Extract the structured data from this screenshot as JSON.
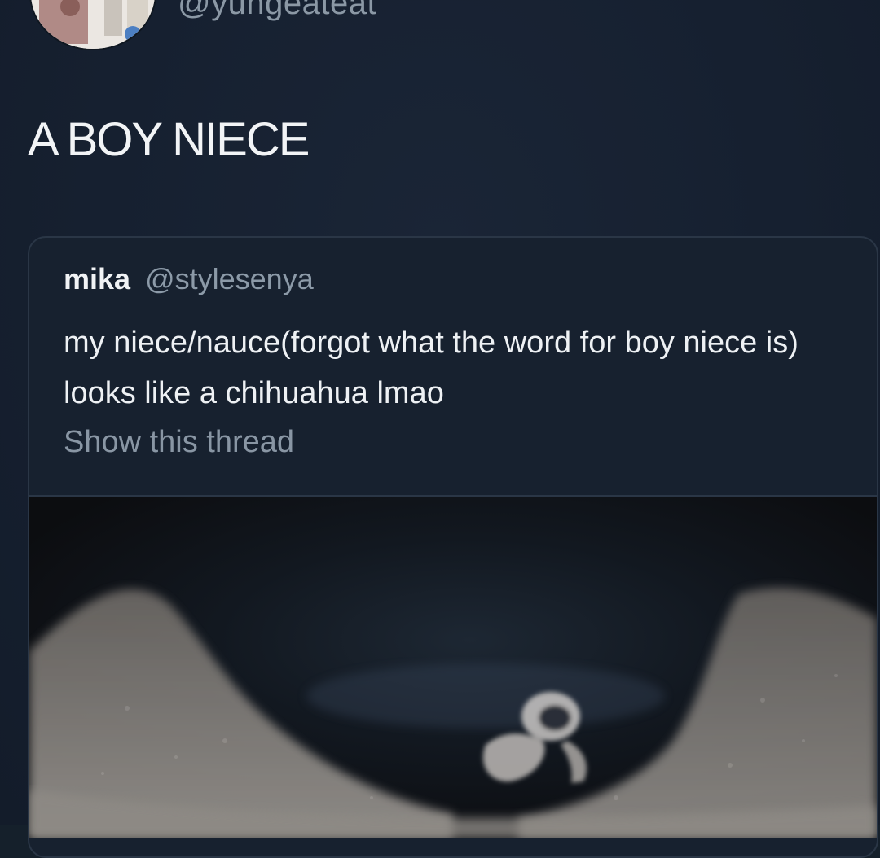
{
  "tweet": {
    "handle": "@yungeateat",
    "text": "A BOY NIECE"
  },
  "quoted_tweet": {
    "name": "mika",
    "handle": "@stylesenya",
    "text": "my niece/nauce(forgot what the word for boy niece is) looks like a chihuahua lmao",
    "show_thread_label": "Show this thread"
  },
  "media": {
    "kind": "ultrasound-image"
  }
}
